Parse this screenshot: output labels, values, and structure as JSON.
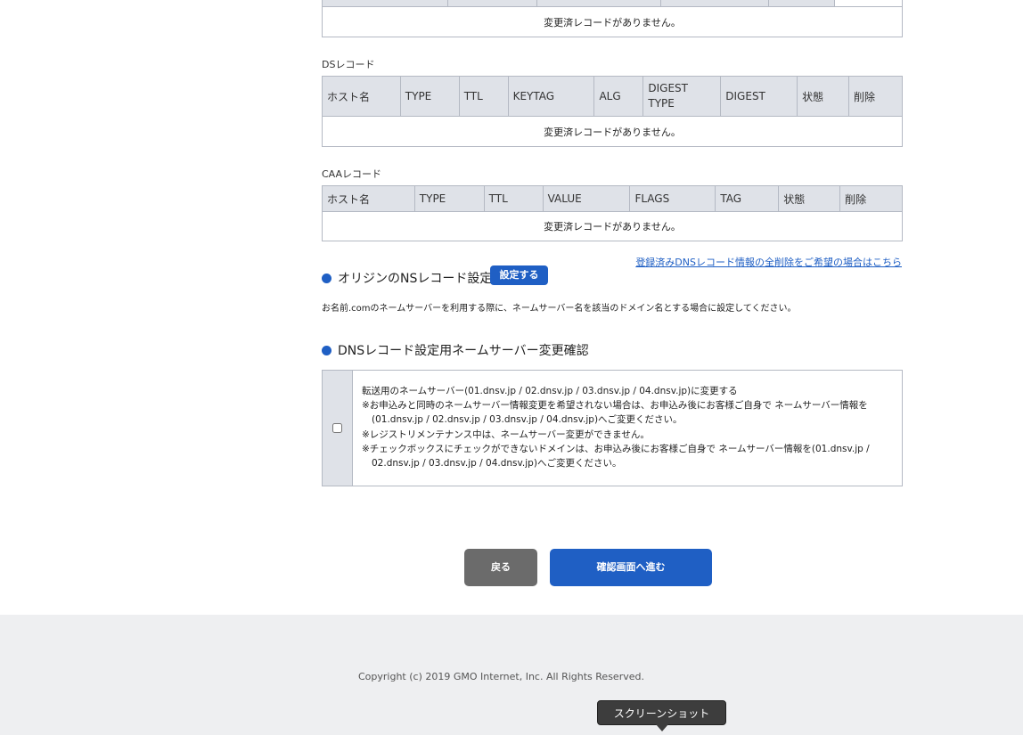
{
  "top_table": {
    "empty_message": "変更済レコードがありません。"
  },
  "ds_section": {
    "label": "DSレコード",
    "headers": [
      "ホスト名",
      "TYPE",
      "TTL",
      "KEYTAG",
      "ALG",
      "DIGEST TYPE",
      "DIGEST",
      "状態",
      "削除"
    ],
    "empty_message": "変更済レコードがありません。"
  },
  "caa_section": {
    "label": "CAAレコード",
    "headers": [
      "ホスト名",
      "TYPE",
      "TTL",
      "VALUE",
      "FLAGS",
      "TAG",
      "状態",
      "削除"
    ],
    "empty_message": "変更済レコードがありません。"
  },
  "delete_all_link": "登録済みDNSレコード情報の全削除をご希望の場合はこちら",
  "origin_ns": {
    "title": "オリジンのNSレコード設定",
    "set_button": "設定する",
    "description": "お名前.comのネームサーバーを利用する際に、ネームサーバー名を該当のドメイン名とする場合に設定してください。"
  },
  "ns_change": {
    "title": "DNSレコード設定用ネームサーバー変更確認",
    "checked": false,
    "line1": "転送用のネームサーバー(01.dnsv.jp / 02.dnsv.jp / 03.dnsv.jp / 04.dnsv.jp)に変更する",
    "line2": "※お申込みと同時のネームサーバー情報変更を希望されない場合は、お申込み後にお客様ご自身で ネームサーバー情報を",
    "line3": "(01.dnsv.jp / 02.dnsv.jp / 03.dnsv.jp / 04.dnsv.jp)へご変更ください。",
    "line4": "※レジストリメンテナンス中は、ネームサーバー変更ができません。",
    "line5": "※チェックボックスにチェックができないドメインは、お申込み後にお客様ご自身で ネームサーバー情報を(01.dnsv.jp /",
    "line6": "02.dnsv.jp / 03.dnsv.jp / 04.dnsv.jp)へご変更ください。"
  },
  "buttons": {
    "back": "戻る",
    "next": "確認画面へ進む"
  },
  "footer": {
    "copyright": "Copyright (c) 2019 GMO Internet, Inc. All Rights Reserved."
  },
  "tooltip": "スクリーンショット",
  "colors": {
    "accent": "#1f5fc4",
    "header_bg": "#dfe2e8",
    "back_button": "#6b6b6b",
    "footer_bg": "#eeeff1"
  }
}
